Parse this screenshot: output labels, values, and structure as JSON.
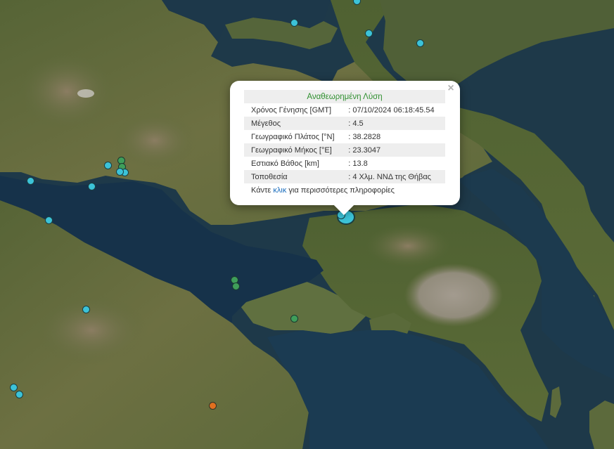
{
  "popup": {
    "title": "Αναθεωρημένη Λύση",
    "rows": [
      {
        "label": "Χρόνος Γένησης [GMT]",
        "value": ": 07/10/2024 06:18:45.54"
      },
      {
        "label": "Μέγεθος",
        "value": ": 4.5"
      },
      {
        "label": "Γεωγραφικό Πλάτος [°N]",
        "value": ": 38.2828"
      },
      {
        "label": "Γεωγραφικό Μήκος [°E]",
        "value": ": 23.3047"
      },
      {
        "label": "Εστιακό Βάθος [km]",
        "value": ": 13.8"
      },
      {
        "label": "Τοποθεσία",
        "value": ": 4 Χλμ. ΝΝΔ της Θήβας"
      }
    ],
    "more_prefix": "Κάντε ",
    "more_link": "κλικ",
    "more_suffix": " για περισσότερες πληροφορίες",
    "close_symbol": "×"
  },
  "marker_colors": {
    "cyan": "#3cc3d8",
    "green": "#3f9e5a",
    "orange": "#e0701f"
  },
  "map_colors": {
    "sea": "#1f3b4a",
    "land": "#5a6a3a"
  }
}
